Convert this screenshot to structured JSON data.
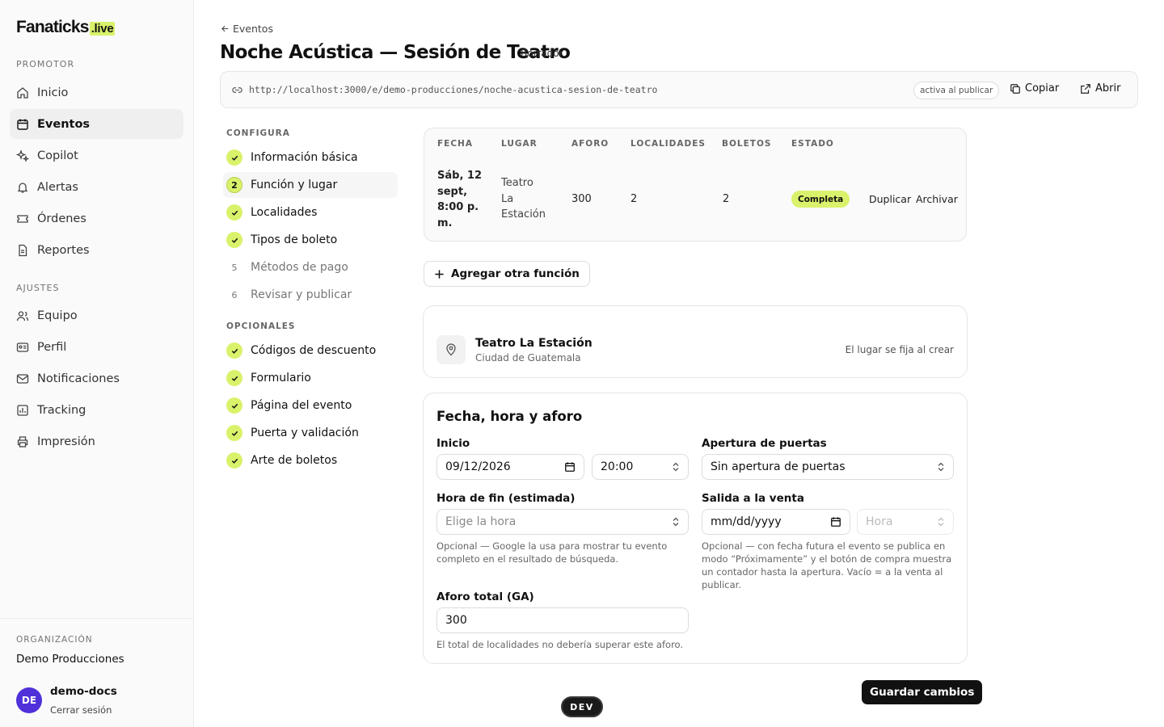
{
  "brand": {
    "name": "Fanaticks",
    "suffix": ".live",
    "accent": "#d9f26b"
  },
  "sidebar": {
    "section_promotor": "PROMOTOR",
    "promotor_items": [
      {
        "label": "Inicio",
        "icon": "home-icon"
      },
      {
        "label": "Eventos",
        "icon": "calendar-icon",
        "active": true
      },
      {
        "label": "Copilot",
        "icon": "sparkles-icon"
      },
      {
        "label": "Alertas",
        "icon": "bell-icon"
      },
      {
        "label": "Órdenes",
        "icon": "ticket-icon"
      },
      {
        "label": "Reportes",
        "icon": "file-report-icon"
      }
    ],
    "section_ajustes": "AJUSTES",
    "ajustes_items": [
      {
        "label": "Equipo",
        "icon": "users-icon"
      },
      {
        "label": "Perfil",
        "icon": "id-card-icon"
      },
      {
        "label": "Notificaciones",
        "icon": "mail-icon"
      },
      {
        "label": "Tracking",
        "icon": "chart-icon"
      },
      {
        "label": "Impresión",
        "icon": "printer-icon"
      }
    ],
    "org_label": "ORGANIZACIÓN",
    "org_name": "Demo Producciones",
    "user_initials": "DE",
    "user_name": "demo-docs",
    "logout": "Cerrar sesión"
  },
  "header": {
    "back": "Eventos",
    "title": "Noche Acústica — Sesión de Teatro",
    "badge": "Borrador",
    "url": "http://localhost:3000/e/demo-producciones/noche-acustica-sesion-de-teatro",
    "url_status": "activa al publicar",
    "copy": "Copiar",
    "open": "Abrir"
  },
  "steps": {
    "configura_label": "CONFIGURA",
    "configura": [
      {
        "label": "Información básica",
        "state": "done"
      },
      {
        "label": "Función y lugar",
        "state": "current",
        "num": "2"
      },
      {
        "label": "Localidades",
        "state": "done"
      },
      {
        "label": "Tipos de boleto",
        "state": "done"
      },
      {
        "label": "Métodos de pago",
        "state": "pending",
        "num": "5"
      },
      {
        "label": "Revisar y publicar",
        "state": "pending",
        "num": "6"
      }
    ],
    "opcionales_label": "OPCIONALES",
    "opcionales": [
      {
        "label": "Códigos de descuento",
        "state": "done"
      },
      {
        "label": "Formulario",
        "state": "done"
      },
      {
        "label": "Página del evento",
        "state": "done"
      },
      {
        "label": "Puerta y validación",
        "state": "done"
      },
      {
        "label": "Arte de boletos",
        "state": "done"
      }
    ]
  },
  "functions_table": {
    "headers": [
      "FECHA",
      "LUGAR",
      "AFORO",
      "LOCALIDADES",
      "BOLETOS",
      "ESTADO"
    ],
    "row": {
      "fecha": [
        "Sáb, 12",
        "sept,",
        "8:00 p.",
        "m."
      ],
      "lugar": [
        "Teatro",
        "La",
        "Estación"
      ],
      "aforo": "300",
      "localidades": "2",
      "boletos": "2",
      "estado": "Completa",
      "duplicate": "Duplicar",
      "archive": "Archivar"
    }
  },
  "add_function": "Agregar otra función",
  "venue": {
    "name": "Teatro La Estación",
    "city": "Ciudad de Guatemala",
    "note": "El lugar se fija al crear"
  },
  "form": {
    "title": "Fecha, hora y aforo",
    "start_label": "Inicio",
    "start_date": "09/12/2026",
    "start_time": "20:00",
    "doors_label": "Apertura de puertas",
    "doors_value": "Sin apertura de puertas",
    "end_label": "Hora de fin (estimada)",
    "end_placeholder": "Elige la hora",
    "end_hint": "Opcional — Google la usa para mostrar tu evento completo en el resultado de búsqueda.",
    "sale_label": "Salida a la venta",
    "sale_date_placeholder": "mm/dd/yyyy",
    "sale_time_placeholder": "Hora",
    "sale_hint": "Opcional — con fecha futura el evento se publica en modo “Próximamente” y el botón de compra muestra un contador hasta la apertura. Vacío = a la venta al publicar.",
    "capacity_label": "Aforo total (GA)",
    "capacity_value": "300",
    "capacity_hint": "El total de localidades no debería superar este aforo."
  },
  "save": "Guardar cambios",
  "dev": "DEV"
}
